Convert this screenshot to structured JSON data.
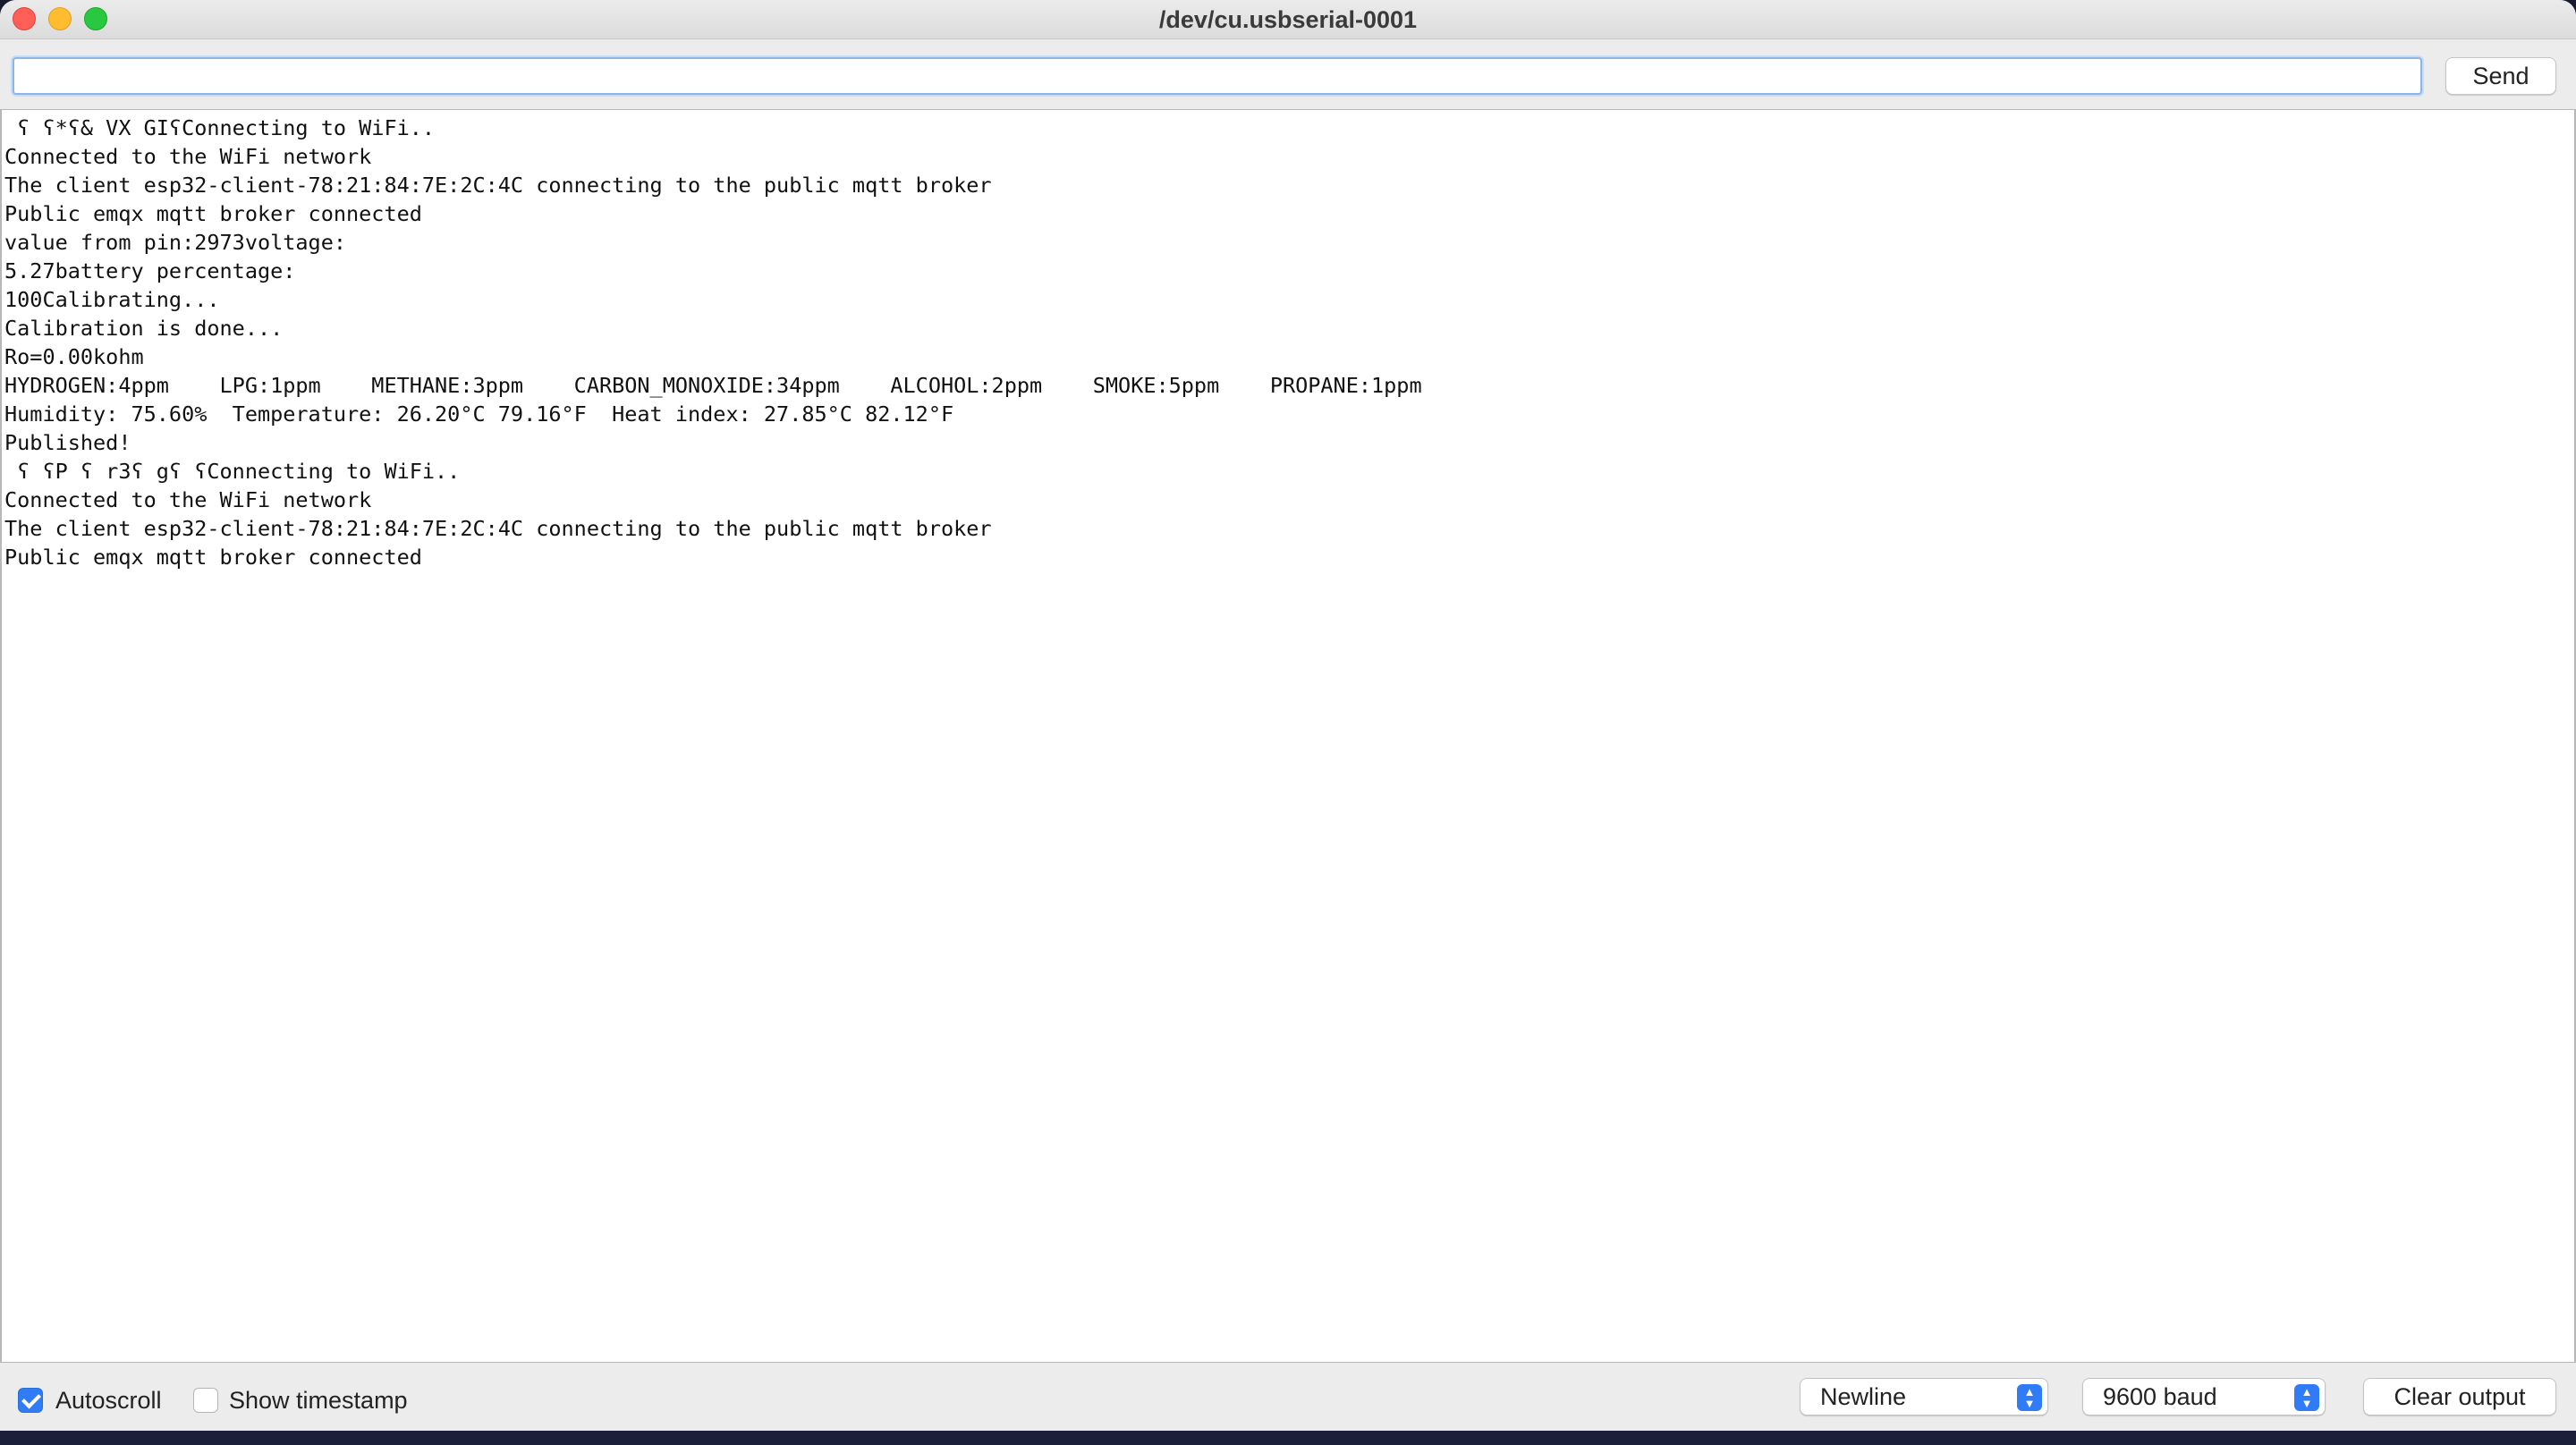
{
  "window": {
    "title": "/dev/cu.usbserial-0001"
  },
  "input_row": {
    "input_value": "",
    "send_label": "Send"
  },
  "output": {
    "lines": [
      " ʕ ʕ*ʕ& VX GIʕConnecting to WiFi..",
      "Connected to the WiFi network",
      "The client esp32-client-78:21:84:7E:2C:4C connecting to the public mqtt broker",
      "Public emqx mqtt broker connected",
      "value from pin:2973voltage:",
      "5.27battery percentage:",
      "100Calibrating...",
      "Calibration is done...",
      "Ro=0.00kohm",
      "HYDROGEN:4ppm    LPG:1ppm    METHANE:3ppm    CARBON_MONOXIDE:34ppm    ALCOHOL:2ppm    SMOKE:5ppm    PROPANE:1ppm",
      "Humidity: 75.60%  Temperature: 26.20°C 79.16°F  Heat index: 27.85°C 82.12°F",
      "Published!",
      " ʕ ʕP ʕ r3ʕ gʕ ʕConnecting to WiFi..",
      "Connected to the WiFi network",
      "The client esp32-client-78:21:84:7E:2C:4C connecting to the public mqtt broker",
      "Public emqx mqtt broker connected"
    ]
  },
  "bottom_bar": {
    "autoscroll_label": "Autoscroll",
    "autoscroll_checked": true,
    "timestamp_label": "Show timestamp",
    "timestamp_checked": false,
    "line_ending": "Newline",
    "baud_rate": "9600 baud",
    "clear_label": "Clear output"
  },
  "colors": {
    "accent": "#2f7cf6",
    "close": "#ff5f57",
    "minimize": "#febc2e",
    "zoom": "#28c840"
  }
}
